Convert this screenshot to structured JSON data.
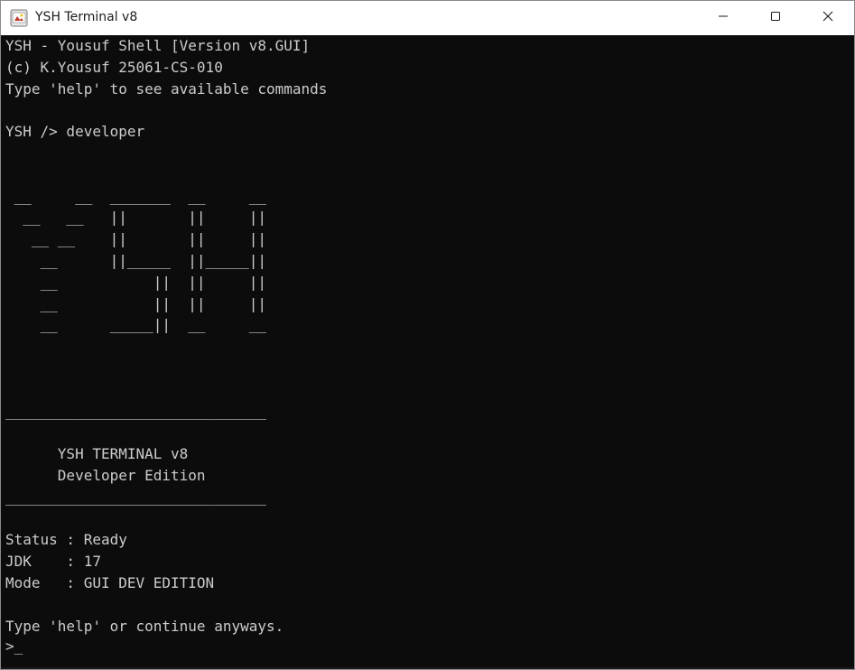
{
  "window": {
    "title": "YSH Terminal v8",
    "icon": "java-app-icon"
  },
  "controls": {
    "minimize": "minimize-icon",
    "maximize": "maximize-icon",
    "close": "close-icon"
  },
  "terminal": {
    "background": "#0c0c0c",
    "foreground": "#cccccc",
    "lines": [
      "YSH - Yousuf Shell [Version v8.GUI]",
      "(c) K.Yousuf 25061-CS-010",
      "Type 'help' to see available commands",
      "",
      "YSH /> developer",
      "",
      "",
      " __     __  _______  __     __",
      "  __   __   ||       ||     ||",
      "   __ __    ||       ||     ||",
      "    __      ||_____  ||_____||",
      "    __           ||  ||     ||",
      "    __           ||  ||     ||",
      "    __      _____||  __     __",
      "",
      "",
      "",
      "______________________________",
      "",
      "      YSH TERMINAL v8",
      "      Developer Edition",
      "______________________________",
      "",
      "Status : Ready",
      "JDK    : 17",
      "Mode   : GUI DEV EDITION",
      "",
      "Type 'help' or continue anyways."
    ],
    "prompt": ">_"
  }
}
